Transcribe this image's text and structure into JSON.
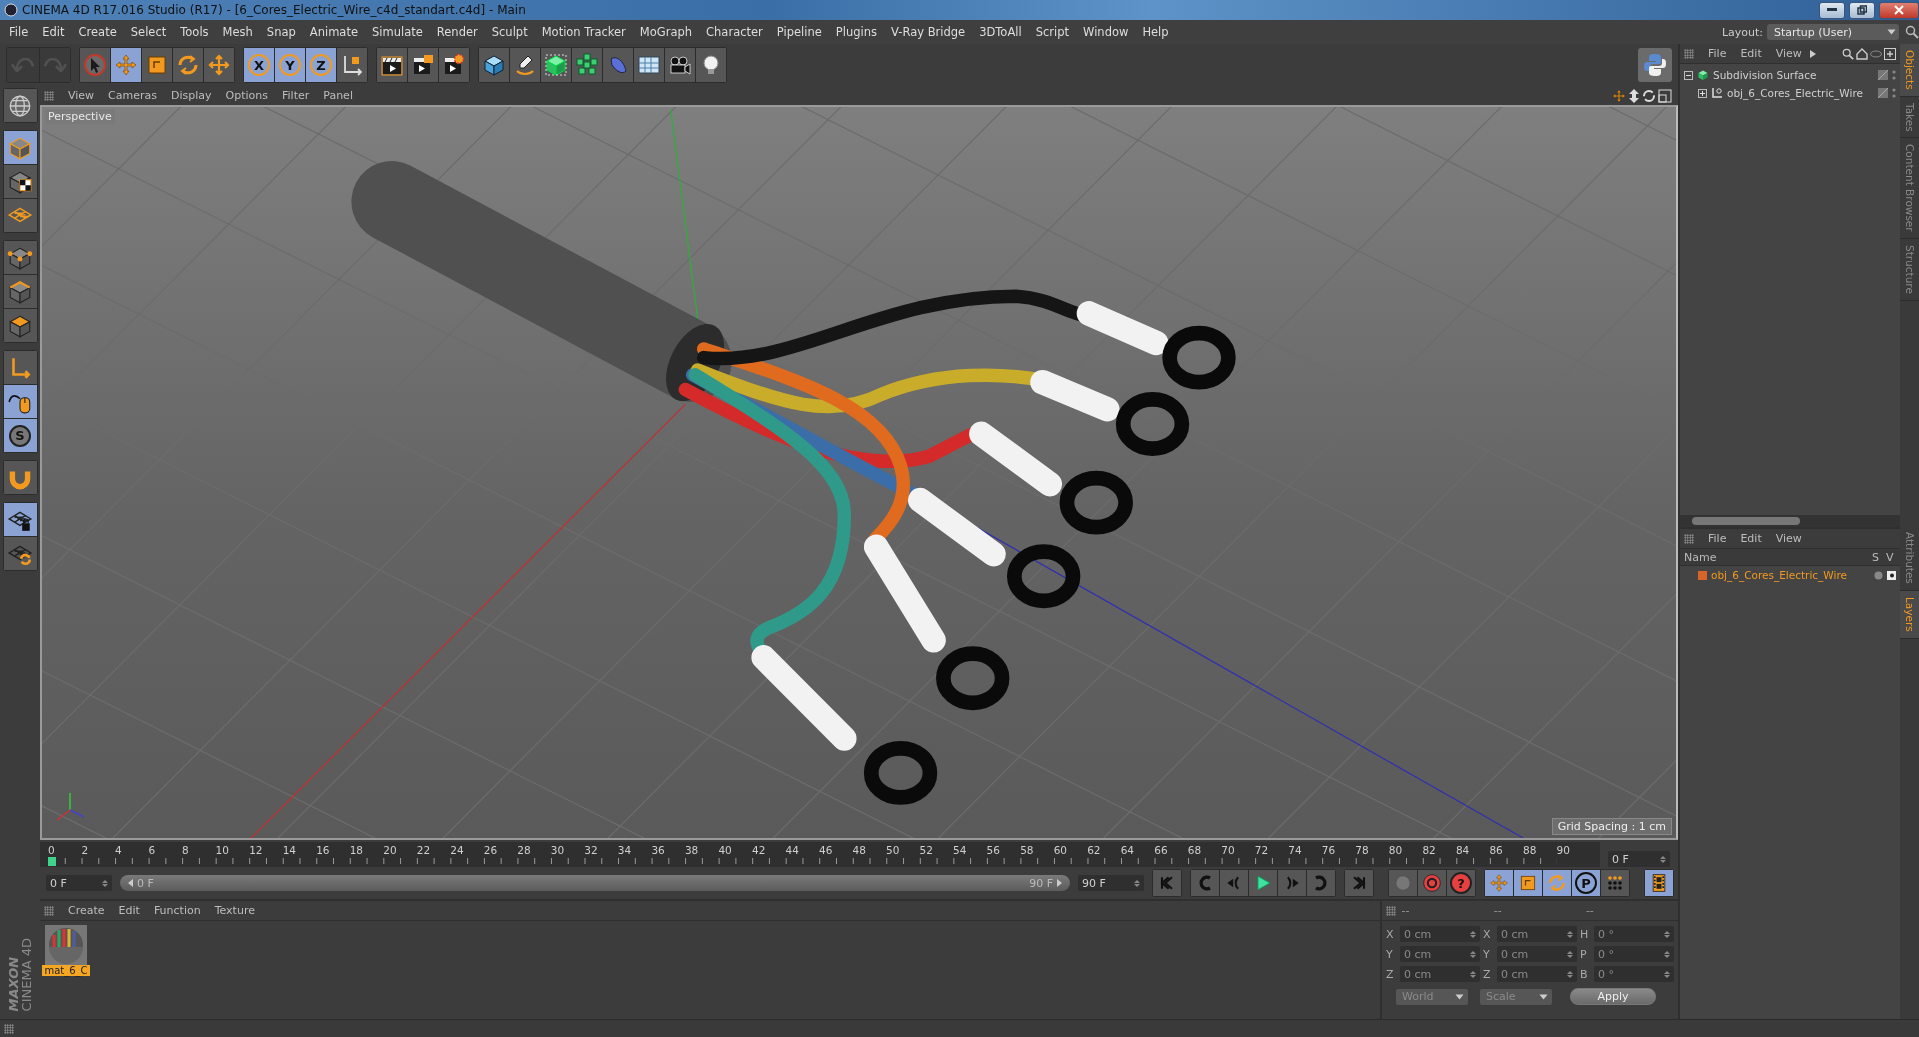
{
  "window": {
    "title": "CINEMA 4D R17.016 Studio (R17) - [6_Cores_Electric_Wire_c4d_standart.c4d] - Main"
  },
  "menu_bar": {
    "items": [
      "File",
      "Edit",
      "Create",
      "Select",
      "Tools",
      "Mesh",
      "Snap",
      "Animate",
      "Simulate",
      "Render",
      "Sculpt",
      "Motion Tracker",
      "MoGraph",
      "Character",
      "Pipeline",
      "Plugins",
      "V-Ray Bridge",
      "3DToAll",
      "Script",
      "Window",
      "Help"
    ],
    "layout_label": "Layout:",
    "layout_value": "Startup (User)"
  },
  "toolbar": {
    "groups": [
      {
        "items": [
          {
            "kind": "undo",
            "active": false,
            "disabled": true
          },
          {
            "kind": "redo",
            "active": false,
            "disabled": true
          }
        ]
      },
      {
        "items": [
          {
            "kind": "select",
            "active": false,
            "disabled": false
          },
          {
            "kind": "move",
            "active": true,
            "disabled": false
          },
          {
            "kind": "scale",
            "active": false,
            "disabled": false
          },
          {
            "kind": "rotate",
            "active": false,
            "disabled": false
          },
          {
            "kind": "transform",
            "active": false,
            "disabled": false
          }
        ]
      },
      {
        "items": [
          {
            "kind": "axis",
            "label": "X",
            "active": true,
            "disabled": false
          },
          {
            "kind": "axis",
            "label": "Y",
            "active": true,
            "disabled": false
          },
          {
            "kind": "axis",
            "label": "Z",
            "active": true,
            "disabled": false
          },
          {
            "kind": "coords",
            "active": false,
            "disabled": false
          }
        ]
      },
      {
        "items": [
          {
            "kind": "renderview",
            "active": false,
            "disabled": false
          },
          {
            "kind": "render",
            "active": false,
            "disabled": false
          },
          {
            "kind": "rendersettings",
            "active": false,
            "disabled": false
          }
        ]
      },
      {
        "items": [
          {
            "kind": "cube",
            "active": false,
            "disabled": false
          },
          {
            "kind": "pen",
            "active": false,
            "disabled": false
          },
          {
            "kind": "subdivide",
            "active": false,
            "disabled": false
          },
          {
            "kind": "cloner",
            "active": false,
            "disabled": false
          },
          {
            "kind": "deformer",
            "active": false,
            "disabled": false
          },
          {
            "kind": "floor",
            "active": false,
            "disabled": false
          },
          {
            "kind": "camera",
            "active": false,
            "disabled": false
          },
          {
            "kind": "light",
            "active": false,
            "disabled": false
          }
        ]
      }
    ]
  },
  "left_toolbar": {
    "groups": [
      {
        "items": [
          {
            "kind": "editable",
            "active": false
          }
        ]
      },
      {
        "items": [
          {
            "kind": "model",
            "active": true
          },
          {
            "kind": "texture",
            "active": false
          },
          {
            "kind": "workplane",
            "active": false
          }
        ]
      },
      {
        "items": [
          {
            "kind": "points",
            "active": false
          },
          {
            "kind": "edges",
            "active": false
          },
          {
            "kind": "polygons",
            "active": false
          }
        ]
      },
      {
        "items": [
          {
            "kind": "axes",
            "active": false
          },
          {
            "kind": "tweak",
            "active": true
          },
          {
            "kind": "snap",
            "label": "S",
            "active": true
          }
        ]
      },
      {
        "items": [
          {
            "kind": "magnet",
            "active": false
          }
        ]
      },
      {
        "items": [
          {
            "kind": "lockgrid",
            "active": true
          },
          {
            "kind": "cyclegrid",
            "active": false
          }
        ]
      }
    ]
  },
  "brand": {
    "maker": "MAXON",
    "product": "CINEMA 4D"
  },
  "viewport": {
    "menu": [
      "View",
      "Cameras",
      "Display",
      "Options",
      "Filter",
      "Panel"
    ],
    "label": "Perspective",
    "grid_spacing": "Grid Spacing : 1 cm"
  },
  "timeline": {
    "ticks": [
      "0",
      "2",
      "4",
      "6",
      "8",
      "10",
      "12",
      "14",
      "16",
      "18",
      "20",
      "22",
      "24",
      "26",
      "28",
      "30",
      "32",
      "34",
      "36",
      "38",
      "40",
      "42",
      "44",
      "46",
      "48",
      "50",
      "52",
      "54",
      "56",
      "58",
      "60",
      "62",
      "64",
      "66",
      "68",
      "70",
      "72",
      "74",
      "76",
      "78",
      "80",
      "82",
      "84",
      "86",
      "88",
      "90"
    ],
    "current_frame": "0 F",
    "start_field": "0 F",
    "range": {
      "start": "0 F",
      "end": "90 F",
      "level": 1
    },
    "end_field": "90 F"
  },
  "playback": {
    "groups": [
      {
        "items": [
          {
            "kind": "first",
            "active": false
          }
        ]
      },
      {
        "items": [
          {
            "kind": "prevkey",
            "active": false
          },
          {
            "kind": "prev",
            "active": false
          },
          {
            "kind": "play",
            "active": false
          },
          {
            "kind": "next",
            "active": false
          },
          {
            "kind": "nextkey",
            "active": false
          }
        ]
      },
      {
        "items": [
          {
            "kind": "last",
            "active": false
          }
        ]
      },
      {
        "items": [
          {
            "kind": "keyring",
            "active": false
          },
          {
            "kind": "record",
            "active": false
          },
          {
            "kind": "autokey",
            "label": "?",
            "active": false
          }
        ]
      },
      {
        "items": [
          {
            "kind": "move",
            "active": true
          },
          {
            "kind": "scale",
            "active": true
          },
          {
            "kind": "rotate",
            "active": true
          },
          {
            "kind": "param",
            "label": "P",
            "active": true
          },
          {
            "kind": "dotgrid",
            "active": false
          }
        ]
      },
      {
        "items": [
          {
            "kind": "film",
            "active": true
          }
        ]
      }
    ]
  },
  "materials": {
    "menu": [
      "Create",
      "Edit",
      "Function",
      "Texture"
    ],
    "items": [
      {
        "name": "mat_6_C",
        "selected": true
      }
    ]
  },
  "coordinates": {
    "headers": [
      "--",
      "--",
      "--"
    ],
    "fields": [
      {
        "label": "X",
        "value": "0 cm"
      },
      {
        "label": "X",
        "value": "0 cm"
      },
      {
        "label": "H",
        "value": "0 °"
      },
      {
        "label": "Y",
        "value": "0 cm"
      },
      {
        "label": "Y",
        "value": "0 cm"
      },
      {
        "label": "P",
        "value": "0 °"
      },
      {
        "label": "Z",
        "value": "0 cm"
      },
      {
        "label": "Z",
        "value": "0 cm"
      },
      {
        "label": "B",
        "value": "0 °"
      }
    ],
    "modes": [
      {
        "value": "World",
        "disabled": true
      },
      {
        "value": "Scale",
        "disabled": true
      }
    ],
    "apply": "Apply"
  },
  "objects": {
    "menu": [
      "File",
      "Edit",
      "View"
    ],
    "tree": [
      {
        "name": "Subdivision Surface",
        "kind": "subdivision",
        "expanded": true,
        "children": [
          {
            "name": "obj_6_Cores_Electric_Wire",
            "kind": "null",
            "expanded": false
          }
        ]
      }
    ]
  },
  "layers": {
    "menu": [
      "File",
      "Edit",
      "View"
    ],
    "columns": [
      "Name",
      "S",
      "V"
    ],
    "rows": [
      {
        "name": "obj_6_Cores_Electric_Wire",
        "color": "#d9642a"
      }
    ]
  },
  "side_tabs": {
    "top": [
      {
        "label": "Objects",
        "selected": true
      },
      {
        "label": "Takes",
        "selected": false
      },
      {
        "label": "Content Browser",
        "selected": false
      },
      {
        "label": "Structure",
        "selected": false
      }
    ],
    "bottom": [
      {
        "label": "Attributes",
        "selected": false
      },
      {
        "label": "Layers",
        "selected": true
      }
    ]
  }
}
